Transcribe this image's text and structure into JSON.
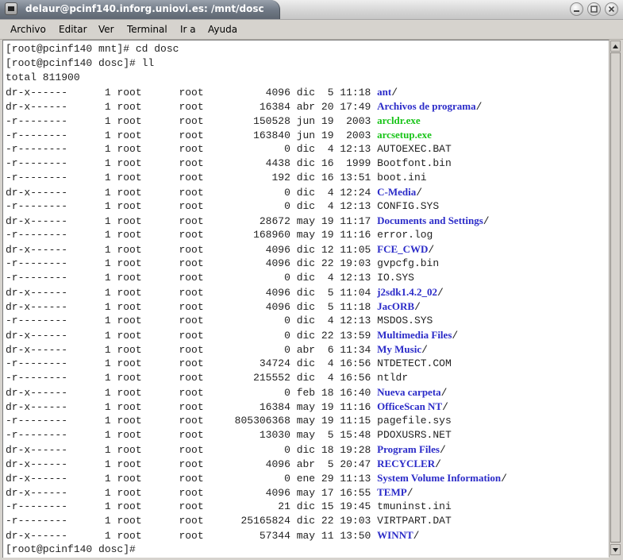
{
  "window": {
    "title": "delaur@pcinf140.inforg.uniovi.es: /mnt/dosc",
    "buttons": [
      "minimize-icon",
      "maximize-icon",
      "close-icon"
    ]
  },
  "menubar": {
    "items": [
      "Archivo",
      "Editar",
      "Ver",
      "Terminal",
      "Ir a",
      "Ayuda"
    ]
  },
  "colors": {
    "directory": "#2b2bc8",
    "executable": "#18c418",
    "text": "#222222",
    "background": "#ffffff"
  },
  "terminal": {
    "lines": [
      {
        "text": "[root@pcinf140 mnt]# cd dosc"
      },
      {
        "text": "[root@pcinf140 dosc]# ll"
      },
      {
        "text": "total 811900"
      },
      {
        "perms": "dr-x------",
        "links": "1",
        "owner": "root",
        "group": "root",
        "size": "4096",
        "month": "dic",
        "day": "5",
        "time": "11:18",
        "name": "ant",
        "type": "dir"
      },
      {
        "perms": "dr-x------",
        "links": "1",
        "owner": "root",
        "group": "root",
        "size": "16384",
        "month": "abr",
        "day": "20",
        "time": "17:49",
        "name": "Archivos de programa",
        "type": "dir"
      },
      {
        "perms": "-r--------",
        "links": "1",
        "owner": "root",
        "group": "root",
        "size": "150528",
        "month": "jun",
        "day": "19",
        "time": "2003",
        "name": "arcldr.exe",
        "type": "exe"
      },
      {
        "perms": "-r--------",
        "links": "1",
        "owner": "root",
        "group": "root",
        "size": "163840",
        "month": "jun",
        "day": "19",
        "time": "2003",
        "name": "arcsetup.exe",
        "type": "exe"
      },
      {
        "perms": "-r--------",
        "links": "1",
        "owner": "root",
        "group": "root",
        "size": "0",
        "month": "dic",
        "day": "4",
        "time": "12:13",
        "name": "AUTOEXEC.BAT",
        "type": "file"
      },
      {
        "perms": "-r--------",
        "links": "1",
        "owner": "root",
        "group": "root",
        "size": "4438",
        "month": "dic",
        "day": "16",
        "time": "1999",
        "name": "Bootfont.bin",
        "type": "file"
      },
      {
        "perms": "-r--------",
        "links": "1",
        "owner": "root",
        "group": "root",
        "size": "192",
        "month": "dic",
        "day": "16",
        "time": "13:51",
        "name": "boot.ini",
        "type": "file"
      },
      {
        "perms": "dr-x------",
        "links": "1",
        "owner": "root",
        "group": "root",
        "size": "0",
        "month": "dic",
        "day": "4",
        "time": "12:24",
        "name": "C-Media",
        "type": "dir"
      },
      {
        "perms": "-r--------",
        "links": "1",
        "owner": "root",
        "group": "root",
        "size": "0",
        "month": "dic",
        "day": "4",
        "time": "12:13",
        "name": "CONFIG.SYS",
        "type": "file"
      },
      {
        "perms": "dr-x------",
        "links": "1",
        "owner": "root",
        "group": "root",
        "size": "28672",
        "month": "may",
        "day": "19",
        "time": "11:17",
        "name": "Documents and Settings",
        "type": "dir"
      },
      {
        "perms": "-r--------",
        "links": "1",
        "owner": "root",
        "group": "root",
        "size": "168960",
        "month": "may",
        "day": "19",
        "time": "11:16",
        "name": "error.log",
        "type": "file"
      },
      {
        "perms": "dr-x------",
        "links": "1",
        "owner": "root",
        "group": "root",
        "size": "4096",
        "month": "dic",
        "day": "12",
        "time": "11:05",
        "name": "FCE_CWD",
        "type": "dir"
      },
      {
        "perms": "-r--------",
        "links": "1",
        "owner": "root",
        "group": "root",
        "size": "4096",
        "month": "dic",
        "day": "22",
        "time": "19:03",
        "name": "gvpcfg.bin",
        "type": "file"
      },
      {
        "perms": "-r--------",
        "links": "1",
        "owner": "root",
        "group": "root",
        "size": "0",
        "month": "dic",
        "day": "4",
        "time": "12:13",
        "name": "IO.SYS",
        "type": "file"
      },
      {
        "perms": "dr-x------",
        "links": "1",
        "owner": "root",
        "group": "root",
        "size": "4096",
        "month": "dic",
        "day": "5",
        "time": "11:04",
        "name": "j2sdk1.4.2_02",
        "type": "dir"
      },
      {
        "perms": "dr-x------",
        "links": "1",
        "owner": "root",
        "group": "root",
        "size": "4096",
        "month": "dic",
        "day": "5",
        "time": "11:18",
        "name": "JacORB",
        "type": "dir"
      },
      {
        "perms": "-r--------",
        "links": "1",
        "owner": "root",
        "group": "root",
        "size": "0",
        "month": "dic",
        "day": "4",
        "time": "12:13",
        "name": "MSDOS.SYS",
        "type": "file"
      },
      {
        "perms": "dr-x------",
        "links": "1",
        "owner": "root",
        "group": "root",
        "size": "0",
        "month": "dic",
        "day": "22",
        "time": "13:59",
        "name": "Multimedia Files",
        "type": "dir"
      },
      {
        "perms": "dr-x------",
        "links": "1",
        "owner": "root",
        "group": "root",
        "size": "0",
        "month": "abr",
        "day": "6",
        "time": "11:34",
        "name": "My Music",
        "type": "dir"
      },
      {
        "perms": "-r--------",
        "links": "1",
        "owner": "root",
        "group": "root",
        "size": "34724",
        "month": "dic",
        "day": "4",
        "time": "16:56",
        "name": "NTDETECT.COM",
        "type": "file"
      },
      {
        "perms": "-r--------",
        "links": "1",
        "owner": "root",
        "group": "root",
        "size": "215552",
        "month": "dic",
        "day": "4",
        "time": "16:56",
        "name": "ntldr",
        "type": "file"
      },
      {
        "perms": "dr-x------",
        "links": "1",
        "owner": "root",
        "group": "root",
        "size": "0",
        "month": "feb",
        "day": "18",
        "time": "16:40",
        "name": "Nueva carpeta",
        "type": "dir"
      },
      {
        "perms": "dr-x------",
        "links": "1",
        "owner": "root",
        "group": "root",
        "size": "16384",
        "month": "may",
        "day": "19",
        "time": "11:16",
        "name": "OfficeScan NT",
        "type": "dir"
      },
      {
        "perms": "-r--------",
        "links": "1",
        "owner": "root",
        "group": "root",
        "size": "805306368",
        "month": "may",
        "day": "19",
        "time": "11:15",
        "name": "pagefile.sys",
        "type": "file"
      },
      {
        "perms": "-r--------",
        "links": "1",
        "owner": "root",
        "group": "root",
        "size": "13030",
        "month": "may",
        "day": "5",
        "time": "15:48",
        "name": "PDOXUSRS.NET",
        "type": "file"
      },
      {
        "perms": "dr-x------",
        "links": "1",
        "owner": "root",
        "group": "root",
        "size": "0",
        "month": "dic",
        "day": "18",
        "time": "19:28",
        "name": "Program Files",
        "type": "dir"
      },
      {
        "perms": "dr-x------",
        "links": "1",
        "owner": "root",
        "group": "root",
        "size": "4096",
        "month": "abr",
        "day": "5",
        "time": "20:47",
        "name": "RECYCLER",
        "type": "dir"
      },
      {
        "perms": "dr-x------",
        "links": "1",
        "owner": "root",
        "group": "root",
        "size": "0",
        "month": "ene",
        "day": "29",
        "time": "11:13",
        "name": "System Volume Information",
        "type": "dir"
      },
      {
        "perms": "dr-x------",
        "links": "1",
        "owner": "root",
        "group": "root",
        "size": "4096",
        "month": "may",
        "day": "17",
        "time": "16:55",
        "name": "TEMP",
        "type": "dir"
      },
      {
        "perms": "-r--------",
        "links": "1",
        "owner": "root",
        "group": "root",
        "size": "21",
        "month": "dic",
        "day": "15",
        "time": "19:45",
        "name": "tmuninst.ini",
        "type": "file"
      },
      {
        "perms": "-r--------",
        "links": "1",
        "owner": "root",
        "group": "root",
        "size": "25165824",
        "month": "dic",
        "day": "22",
        "time": "19:03",
        "name": "VIRTPART.DAT",
        "type": "file"
      },
      {
        "perms": "dr-x------",
        "links": "1",
        "owner": "root",
        "group": "root",
        "size": "57344",
        "month": "may",
        "day": "11",
        "time": "13:50",
        "name": "WINNT",
        "type": "dir"
      },
      {
        "text": "[root@pcinf140 dosc]#"
      }
    ]
  }
}
